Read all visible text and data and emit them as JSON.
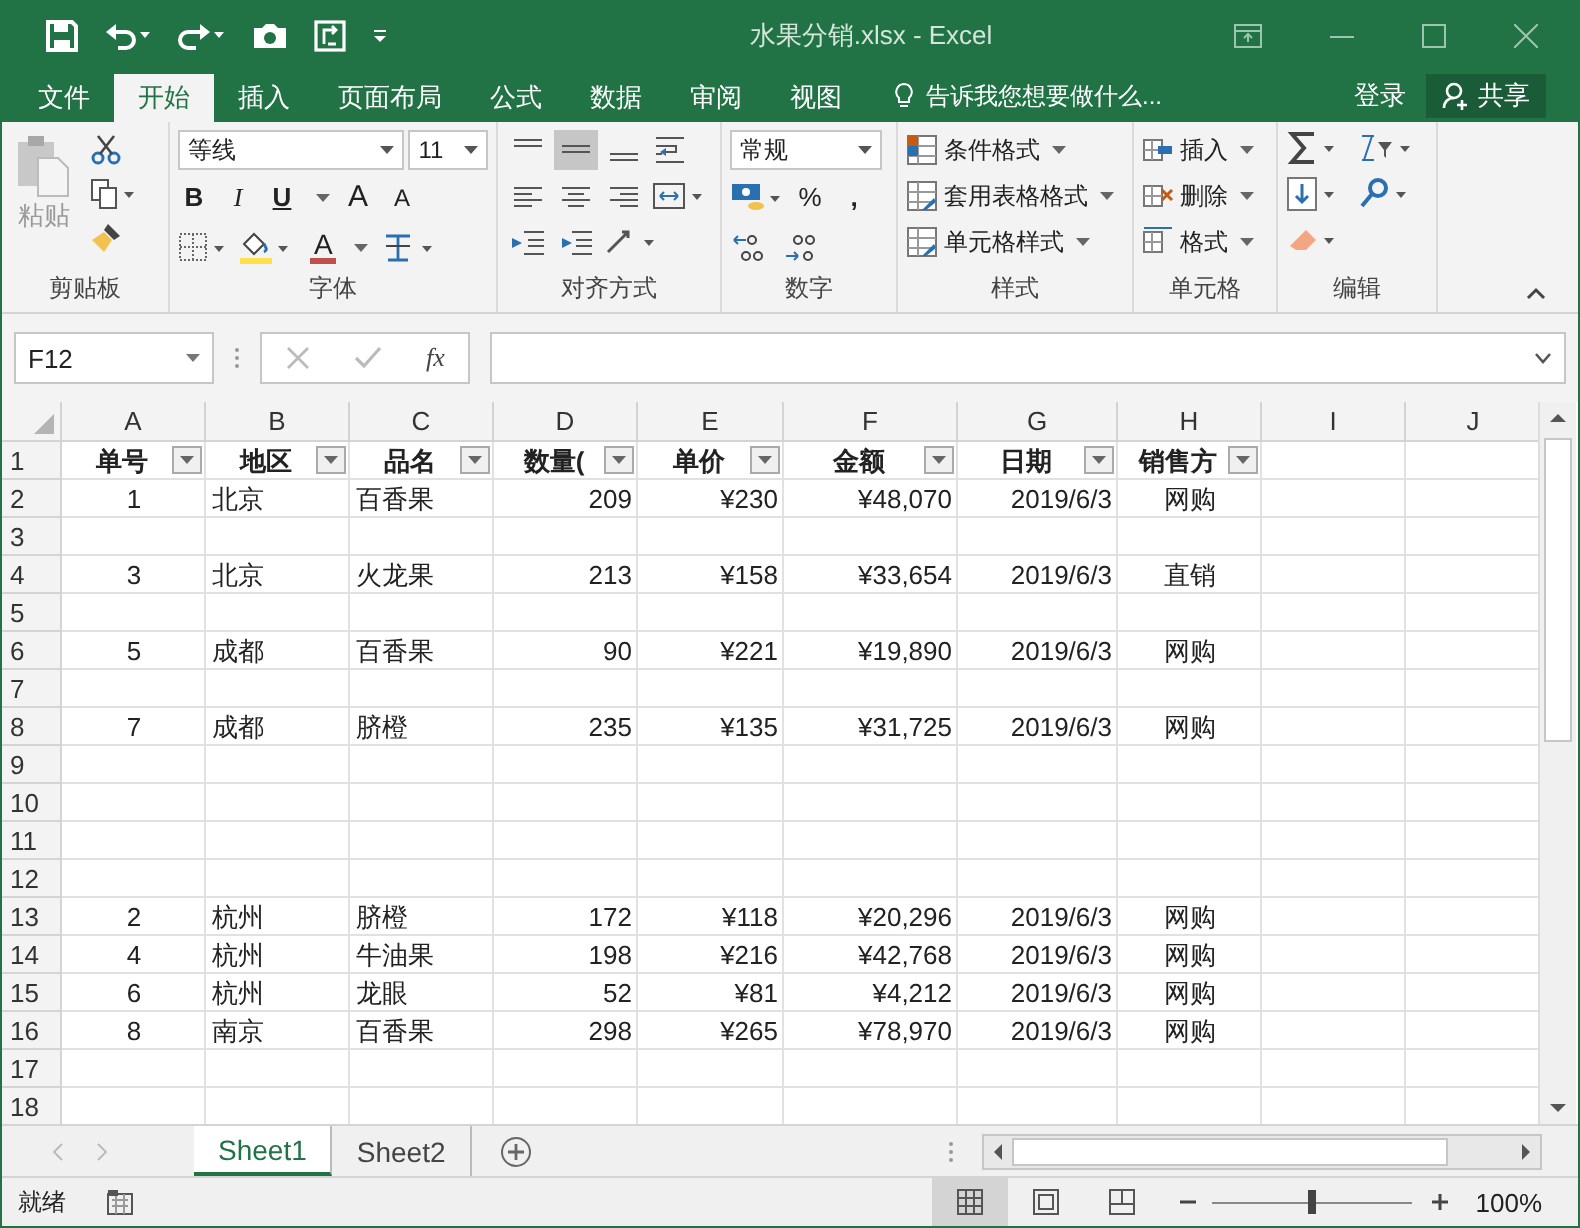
{
  "window": {
    "title": "水果分销.xlsx - Excel"
  },
  "menu_tabs": [
    {
      "label": "文件",
      "selected": false
    },
    {
      "label": "开始",
      "selected": true
    },
    {
      "label": "插入",
      "selected": false
    },
    {
      "label": "页面布局",
      "selected": false
    },
    {
      "label": "公式",
      "selected": false
    },
    {
      "label": "数据",
      "selected": false
    },
    {
      "label": "审阅",
      "selected": false
    },
    {
      "label": "视图",
      "selected": false
    }
  ],
  "tell_me": {
    "placeholder": "告诉我您想要做什么..."
  },
  "account": {
    "login": "登录",
    "share": "共享"
  },
  "ribbon": {
    "clipboard": {
      "label": "剪贴板",
      "paste": "粘贴"
    },
    "font": {
      "label": "字体",
      "font_name": "等线",
      "font_size": "11",
      "bold": "B",
      "italic": "I",
      "underline": "U",
      "grow": "A",
      "shrink": "A",
      "font_color": "A"
    },
    "alignment": {
      "label": "对齐方式",
      "vertical": [
        {
          "selected": false
        },
        {
          "selected": true
        },
        {
          "selected": false
        }
      ]
    },
    "number": {
      "label": "数字",
      "format": "常规",
      "percent": "%",
      "comma": ","
    },
    "styles": {
      "label": "样式",
      "items": [
        "条件格式",
        "套用表格格式",
        "单元格样式"
      ]
    },
    "cells": {
      "label": "单元格",
      "items": [
        "插入",
        "删除",
        "格式"
      ]
    },
    "editing": {
      "label": "编辑"
    }
  },
  "formula_bar": {
    "name_box": "F12",
    "function_button": "fx"
  },
  "sheet": {
    "columns": [
      "A",
      "B",
      "C",
      "D",
      "E",
      "F",
      "G",
      "H",
      "I",
      "J"
    ],
    "header_row": {
      "number": "1",
      "headers": [
        {
          "label": "单号",
          "filter": true
        },
        {
          "label": "地区",
          "filter": true
        },
        {
          "label": "品名",
          "filter": true
        },
        {
          "label": "数量(",
          "filter": true
        },
        {
          "label": "单价",
          "filter": true
        },
        {
          "label": "金额",
          "filter": true
        },
        {
          "label": "日期",
          "filter": true
        },
        {
          "label": "销售方",
          "filter": true
        }
      ]
    },
    "rows": [
      {
        "number": "2",
        "cells": [
          "1",
          "北京",
          "百香果",
          "209",
          "¥230",
          "¥48,070",
          "2019/6/3",
          "网购"
        ]
      },
      {
        "number": "3",
        "cells": []
      },
      {
        "number": "4",
        "cells": [
          "3",
          "北京",
          "火龙果",
          "213",
          "¥158",
          "¥33,654",
          "2019/6/3",
          "直销"
        ]
      },
      {
        "number": "5",
        "cells": []
      },
      {
        "number": "6",
        "cells": [
          "5",
          "成都",
          "百香果",
          "90",
          "¥221",
          "¥19,890",
          "2019/6/3",
          "网购"
        ]
      },
      {
        "number": "7",
        "cells": []
      },
      {
        "number": "8",
        "cells": [
          "7",
          "成都",
          "脐橙",
          "235",
          "¥135",
          "¥31,725",
          "2019/6/3",
          "网购"
        ]
      },
      {
        "number": "9",
        "cells": []
      },
      {
        "number": "10",
        "cells": []
      },
      {
        "number": "11",
        "cells": []
      },
      {
        "number": "12",
        "cells": []
      },
      {
        "number": "13",
        "cells": [
          "2",
          "杭州",
          "脐橙",
          "172",
          "¥118",
          "¥20,296",
          "2019/6/3",
          "网购"
        ]
      },
      {
        "number": "14",
        "cells": [
          "4",
          "杭州",
          "牛油果",
          "198",
          "¥216",
          "¥42,768",
          "2019/6/3",
          "网购"
        ]
      },
      {
        "number": "15",
        "cells": [
          "6",
          "杭州",
          "龙眼",
          "52",
          "¥81",
          "¥4,212",
          "2019/6/3",
          "网购"
        ]
      },
      {
        "number": "16",
        "cells": [
          "8",
          "南京",
          "百香果",
          "298",
          "¥265",
          "¥78,970",
          "2019/6/3",
          "网购"
        ]
      },
      {
        "number": "17",
        "cells": []
      },
      {
        "number": "18",
        "cells": []
      }
    ]
  },
  "sheet_tabs": [
    {
      "label": "Sheet1",
      "selected": true
    },
    {
      "label": "Sheet2",
      "selected": false
    }
  ],
  "status_bar": {
    "status": "就绪",
    "views": [
      {
        "selected": true
      },
      {
        "selected": false
      },
      {
        "selected": false
      }
    ],
    "zoom": {
      "level": 0.5,
      "reading": "100%"
    }
  }
}
